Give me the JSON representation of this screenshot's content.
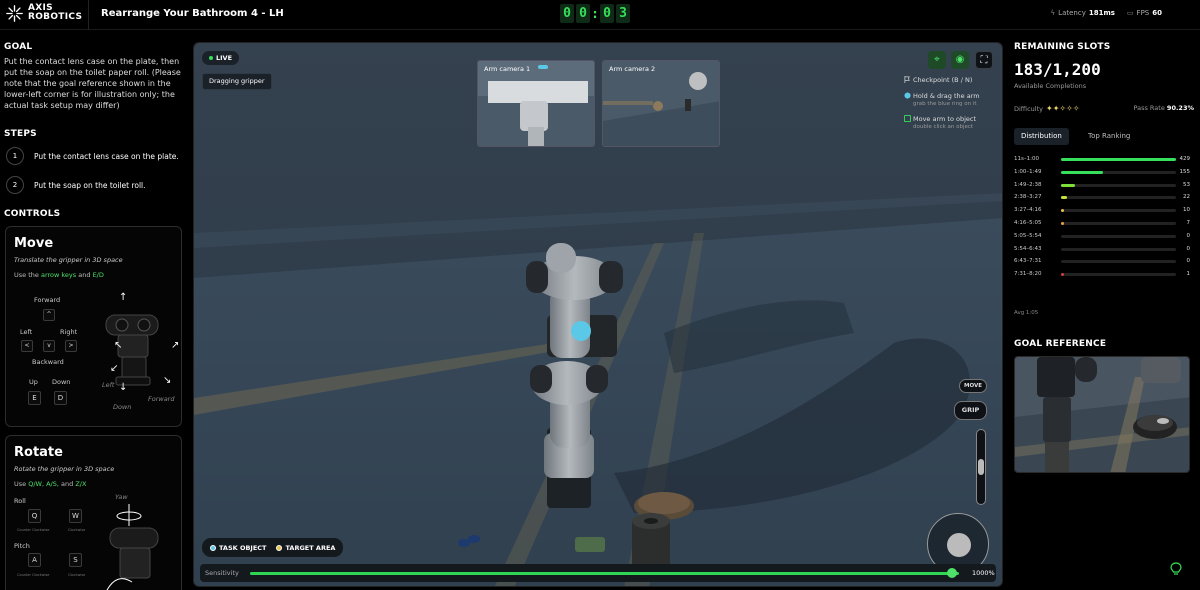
{
  "app": {
    "logo_line1": "AXIS",
    "logo_line2": "ROBOTICS",
    "task_title": "Rearrange Your Bathroom 4 - LH",
    "timer": [
      "0",
      "0",
      "0",
      "3"
    ],
    "latency_label": "Latency",
    "latency_value": "181ms",
    "fps_label": "FPS",
    "fps_value": "60"
  },
  "goal": {
    "heading": "GOAL",
    "text": "Put the contact lens case on the plate, then put the soap on the toilet paper roll. (Please note that the goal reference shown in the lower-left corner is for illustration only; the actual task setup may differ)"
  },
  "steps": {
    "heading": "STEPS",
    "items": [
      {
        "num": "1",
        "label": "Put the contact lens case on the plate."
      },
      {
        "num": "2",
        "label": "Put the soap on the toilet roll."
      }
    ]
  },
  "controls": {
    "heading": "CONTROLS",
    "move": {
      "title": "Move",
      "subtitle": "Translate the gripper in 3D space",
      "hint_prefix": "Use the",
      "hint_keys1": "arrow keys",
      "hint_and": "and",
      "hint_keys2": "E/D",
      "forward": "Forward",
      "left": "Left",
      "right": "Right",
      "backward": "Backward",
      "up": "Up",
      "down": "Down",
      "key_up": "^",
      "key_left": "<",
      "key_down": "v",
      "key_right": ">",
      "key_e": "E",
      "key_d": "D",
      "axis_left": "Left",
      "axis_down": "Down",
      "axis_forward": "Forward"
    },
    "rotate": {
      "title": "Rotate",
      "subtitle": "Rotate the gripper in 3D space",
      "hint_prefix": "Use",
      "hint_keys": "Q/W, A/S,",
      "hint_and": "and",
      "hint_keys2": "Z/X",
      "roll": "Roll",
      "pitch": "Pitch",
      "yaw": "Yaw",
      "key_q": "Q",
      "key_w": "W",
      "key_a": "A",
      "key_s": "S",
      "ccw": "Counter Clockwise",
      "cw": "Clockwise"
    }
  },
  "viewport": {
    "live": "LIVE",
    "dragging": "Dragging gripper",
    "cam1": "Arm camera 1",
    "cam2": "Arm camera 2",
    "checkpoint": "Checkpoint (B / N)",
    "hold_drag": "Hold & drag the arm",
    "hold_drag_sub": "grab the blue ring on it",
    "move_arm": "Move arm to object",
    "move_arm_sub": "double click an object",
    "move_btn": "MOVE",
    "grip_btn": "GRIP",
    "task_object": "TASK OBJECT",
    "target_area": "TARGET AREA",
    "sensitivity_label": "Sensitivity",
    "sensitivity_value": "1000%",
    "sensitivity_fraction": 0.99,
    "colors": {
      "task": "#5ac8e6",
      "target": "#e8c44a",
      "accent": "#36e05a"
    }
  },
  "slots": {
    "heading": "REMAINING SLOTS",
    "value": "183/1,200",
    "sub": "Available Completions",
    "difficulty_label": "Difficulty",
    "difficulty_stars": "✦✦✧✧✧",
    "pass_label": "Pass Rate",
    "pass_value": "90.23%"
  },
  "tabs": {
    "distribution": "Distribution",
    "ranking": "Top Ranking"
  },
  "distribution": [
    {
      "label": "11s–1:00",
      "count": 429,
      "color": "#36e05a"
    },
    {
      "label": "1:00–1:49",
      "count": 155,
      "color": "#36e05a"
    },
    {
      "label": "1:49–2:38",
      "count": 53,
      "color": "#7fdf3a"
    },
    {
      "label": "2:38–3:27",
      "count": 22,
      "color": "#c8e03a"
    },
    {
      "label": "3:27–4:16",
      "count": 10,
      "color": "#e8c03a"
    },
    {
      "label": "4:16–5:05",
      "count": 7,
      "color": "#e8a03a"
    },
    {
      "label": "5:05–5:54",
      "count": 0,
      "color": "#e8803a"
    },
    {
      "label": "5:54–6:43",
      "count": 0,
      "color": "#e8603a"
    },
    {
      "label": "6:43–7:31",
      "count": 0,
      "color": "#e8403a"
    },
    {
      "label": "7:31–8:20",
      "count": 1,
      "color": "#d63a3a"
    }
  ],
  "avg": "Avg 1:05",
  "goal_reference": {
    "heading": "GOAL REFERENCE"
  }
}
